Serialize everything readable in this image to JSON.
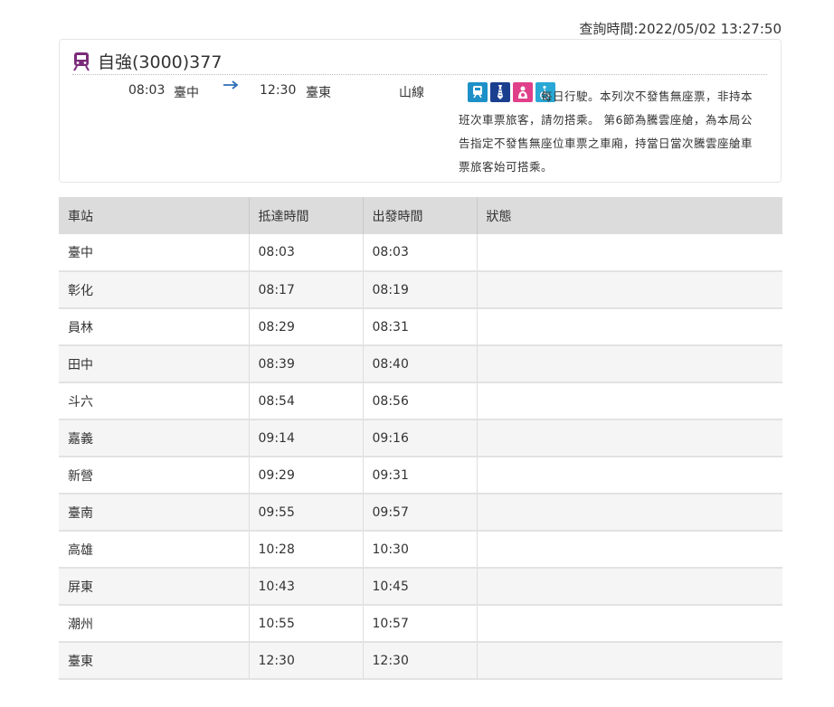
{
  "query_time": "查詢時間:2022/05/02 13:27:50",
  "train": {
    "name": "自強(3000)377",
    "departure_time": "08:03",
    "departure_station": "臺中",
    "arrival_time": "12:30",
    "arrival_station": "臺東",
    "line": "山線",
    "note": "每日行駛。本列次不發售無座票，非持本班次車票旅客，請勿搭乘。 第6節為騰雲座艙，為本局公告指定不發售無座位車票之車廂，持當日當次騰雲座艙車票旅客始可搭乘。",
    "icons": [
      {
        "name": "train-service-icon",
        "color": "#1e90c8"
      },
      {
        "name": "business-tie-icon",
        "color": "#1a3f8f"
      },
      {
        "name": "baby-care-icon",
        "color": "#e0408a"
      },
      {
        "name": "wheelchair-icon",
        "color": "#29a8d6"
      }
    ]
  },
  "table": {
    "headers": [
      "車站",
      "抵達時間",
      "出發時間",
      "狀態"
    ],
    "rows": [
      {
        "station": "臺中",
        "arrive": "08:03",
        "depart": "08:03",
        "status": ""
      },
      {
        "station": "彰化",
        "arrive": "08:17",
        "depart": "08:19",
        "status": ""
      },
      {
        "station": "員林",
        "arrive": "08:29",
        "depart": "08:31",
        "status": ""
      },
      {
        "station": "田中",
        "arrive": "08:39",
        "depart": "08:40",
        "status": ""
      },
      {
        "station": "斗六",
        "arrive": "08:54",
        "depart": "08:56",
        "status": ""
      },
      {
        "station": "嘉義",
        "arrive": "09:14",
        "depart": "09:16",
        "status": ""
      },
      {
        "station": "新營",
        "arrive": "09:29",
        "depart": "09:31",
        "status": ""
      },
      {
        "station": "臺南",
        "arrive": "09:55",
        "depart": "09:57",
        "status": ""
      },
      {
        "station": "高雄",
        "arrive": "10:28",
        "depart": "10:30",
        "status": ""
      },
      {
        "station": "屏東",
        "arrive": "10:43",
        "depart": "10:45",
        "status": ""
      },
      {
        "station": "潮州",
        "arrive": "10:55",
        "depart": "10:57",
        "status": ""
      },
      {
        "station": "臺東",
        "arrive": "12:30",
        "depart": "12:30",
        "status": ""
      }
    ]
  }
}
